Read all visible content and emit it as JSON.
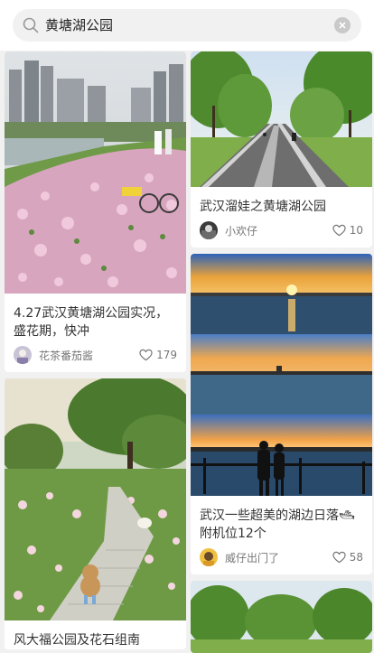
{
  "search": {
    "query": "黄塘湖公园"
  },
  "cards": [
    {
      "title_line1": "4.27武汉黄塘湖公园实况，",
      "title_line2": "盛花期，快冲",
      "author": "花茶番茄酱",
      "likes": "179"
    },
    {
      "title_line1": "武汉溜娃之黄塘湖公园",
      "title_line2": "",
      "author": "小欢仔",
      "likes": "10"
    },
    {
      "title_line1": "武汉一些超美的湖边日落🛥",
      "title_line2": "附机位12个",
      "author": "威仔出门了",
      "likes": "58"
    },
    {
      "title_line1": "风大福公园及花石组南",
      "title_line2": "",
      "author": "",
      "likes": ""
    }
  ],
  "icons": {
    "search": "search-icon",
    "clear": "clear-icon",
    "heart": "heart-icon"
  }
}
